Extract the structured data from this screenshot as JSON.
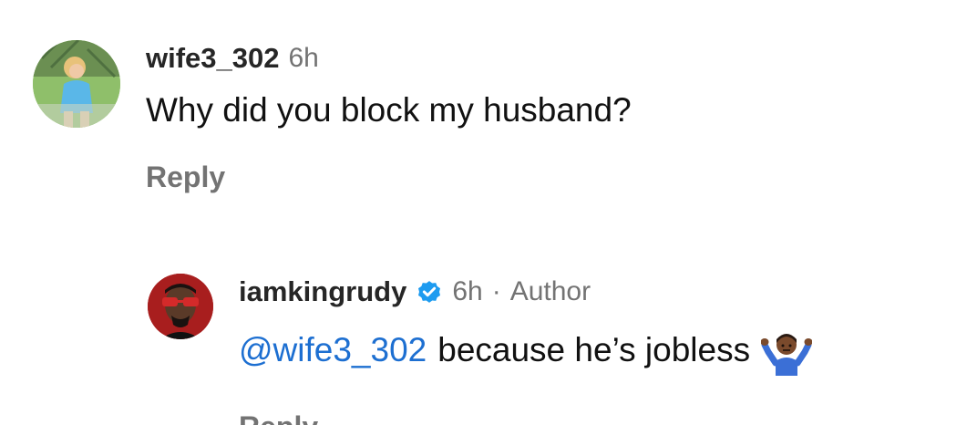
{
  "comments": [
    {
      "username": "wife3_302",
      "time": "6h",
      "text": "Why did you block my husband?",
      "reply_label": "Reply",
      "avatar_colors": {
        "bg": "#8fbf6a",
        "figure": "#5ab7e8",
        "hair": "#e8c27a"
      }
    }
  ],
  "replies": [
    {
      "username": "iamkingrudy",
      "verified": true,
      "time": "6h",
      "separator": "·",
      "author_tag": "Author",
      "mention": "@wife3_302",
      "text": "because he’s jobless",
      "emoji_name": "person-shrugging-emoji",
      "reply_label": "Reply",
      "avatar_colors": {
        "bg": "#a81e1e",
        "skin": "#5a3a28",
        "glasses": "#d42a2a"
      }
    }
  ],
  "colors": {
    "username": "#262626",
    "meta": "#737373",
    "mention": "#1d6fd1",
    "verified": "#1d9bf0",
    "text": "#111111"
  }
}
